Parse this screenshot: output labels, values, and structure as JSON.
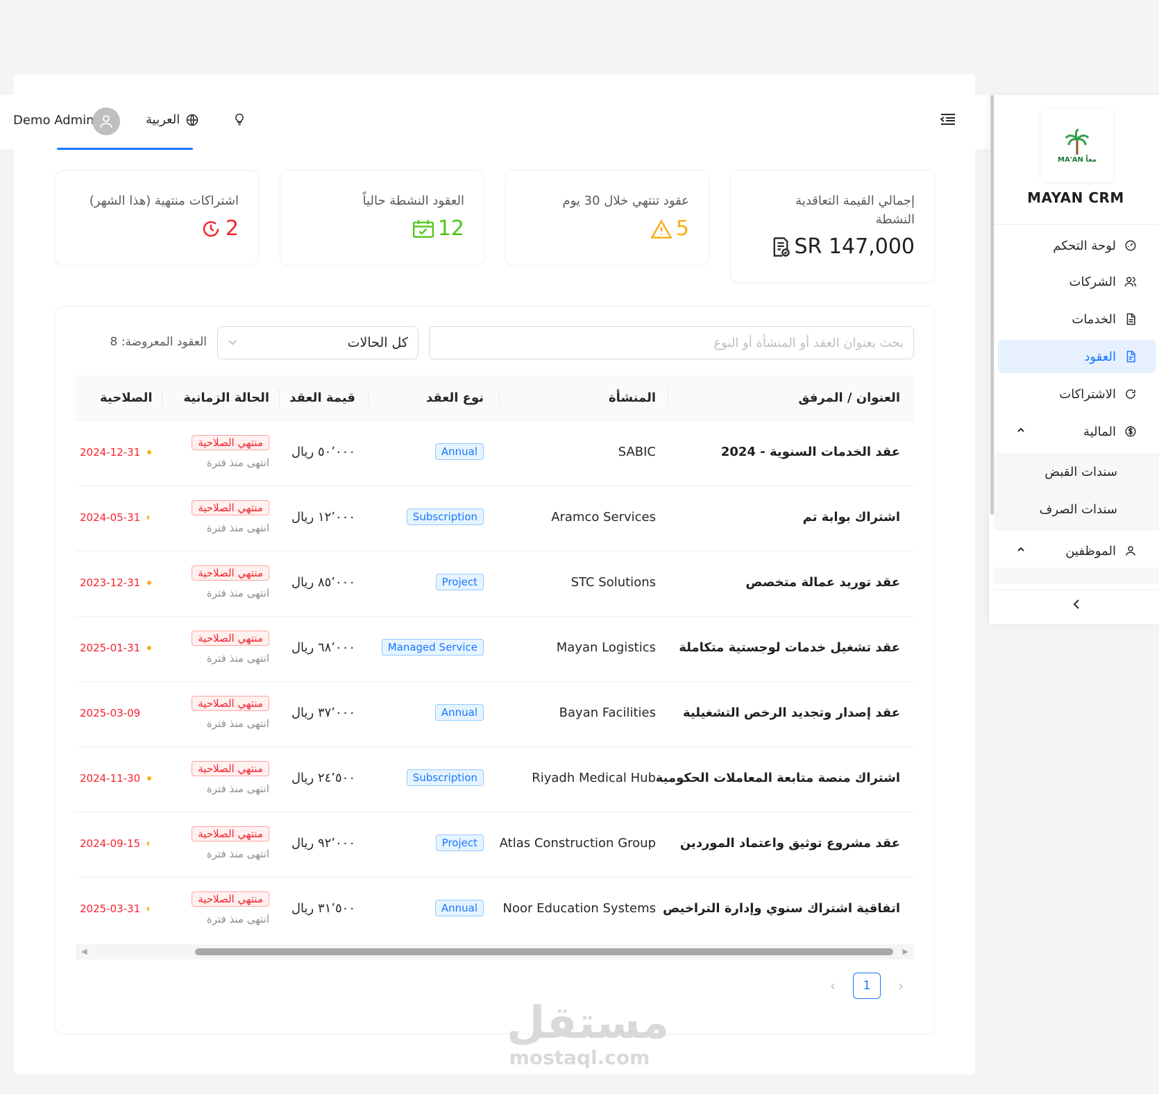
{
  "header": {
    "user_name": "Demo Admin",
    "language": "العربية"
  },
  "sidebar": {
    "brand": "MAYAN CRM",
    "logo_text": "MA'AN معاً",
    "items": [
      {
        "label": "لوحة التحكم",
        "icon": "dashboard-icon"
      },
      {
        "label": "الشركات",
        "icon": "companies-icon"
      },
      {
        "label": "الخدمات",
        "icon": "document-icon"
      },
      {
        "label": "العقود",
        "icon": "contract-icon"
      },
      {
        "label": "الاشتراكات",
        "icon": "refresh-icon"
      },
      {
        "label": "المالية",
        "icon": "dollar-icon"
      },
      {
        "label": "الموظفين",
        "icon": "user-icon"
      }
    ],
    "finance_sub": [
      "سندات القبض",
      "سندات الصرف"
    ],
    "active_item": "العقود"
  },
  "stats": [
    {
      "label": "إجمالي القيمة التعاقدية النشطة",
      "value": "SR 147,000",
      "icon": "invoice-icon"
    },
    {
      "label": "عقود تنتهي خلال 30 يوم",
      "value": "5",
      "icon": "warning-icon",
      "color": "#faad14"
    },
    {
      "label": "العقود النشطة حالياً",
      "value": "12",
      "icon": "calendar-check-icon",
      "color": "#52c41a"
    },
    {
      "label": "اشتراكات منتهية (هذا الشهر)",
      "value": "2",
      "icon": "clock-icon",
      "color": "#f5222d"
    }
  ],
  "filters": {
    "search_placeholder": "بحث بعنوان العقد أو المنشأة أو النوع",
    "status_selected": "كل الحالات",
    "count_text": "العقود المعروضة: 8"
  },
  "table": {
    "headers": {
      "title": "العنوان / المرفق",
      "org": "المنشأة",
      "type": "نوع العقد",
      "value": "قيمة العقد",
      "status": "الحالة الزمانية",
      "validity": "الصلاحية"
    },
    "rows": [
      {
        "title": "عقد الخدمات السنوية - 2024",
        "org": "SABIC",
        "type": "Annual",
        "value": "٥٠٬٠٠٠ ريال",
        "badge": "منتهي الصلاحية",
        "sub": "انتهى منذ فترة",
        "date": "2024-12-31",
        "dot": true
      },
      {
        "title": "اشتراك بوابة تم",
        "org": "Aramco Services",
        "type": "Subscription",
        "value": "١٢٬٠٠٠ ريال",
        "badge": "منتهي الصلاحية",
        "sub": "انتهى منذ فترة",
        "date": "2024-05-31",
        "dot": true
      },
      {
        "title": "عقد توريد عمالة متخصص",
        "org": "STC Solutions",
        "type": "Project",
        "value": "٨٥٬٠٠٠ ريال",
        "badge": "منتهي الصلاحية",
        "sub": "انتهى منذ فترة",
        "date": "2023-12-31",
        "dot": true
      },
      {
        "title": "عقد تشغيل خدمات لوجستية متكاملة",
        "org": "Mayan Logistics",
        "type": "Managed Service",
        "value": "٦٨٬٠٠٠ ريال",
        "badge": "منتهي الصلاحية",
        "sub": "انتهى منذ فترة",
        "date": "2025-01-31",
        "dot": true
      },
      {
        "title": "عقد إصدار وتجديد الرخص التشغيلية",
        "org": "Bayan Facilities",
        "type": "Annual",
        "value": "٣٧٬٠٠٠ ريال",
        "badge": "منتهي الصلاحية",
        "sub": "انتهى منذ فترة",
        "date": "2025-03-09",
        "dot": false
      },
      {
        "title": "اشتراك منصة متابعة المعاملات الحكومية",
        "org": "Riyadh Medical Hub",
        "type": "Subscription",
        "value": "٢٤٬٥٠٠ ريال",
        "badge": "منتهي الصلاحية",
        "sub": "انتهى منذ فترة",
        "date": "2024-11-30",
        "dot": true
      },
      {
        "title": "عقد مشروع توثيق واعتماد الموردين",
        "org": "Atlas Construction Group",
        "type": "Project",
        "value": "٩٢٬٠٠٠ ريال",
        "badge": "منتهي الصلاحية",
        "sub": "انتهى منذ فترة",
        "date": "2024-09-15",
        "dot": true
      },
      {
        "title": "اتفاقية اشتراك سنوي وإدارة التراخيص",
        "org": "Noor Education Systems",
        "type": "Annual",
        "value": "٣١٬٥٠٠ ريال",
        "badge": "منتهي الصلاحية",
        "sub": "انتهى منذ فترة",
        "date": "2025-03-31",
        "dot": true
      }
    ]
  },
  "pagination": {
    "current": "1"
  },
  "watermark": {
    "big": "مستقل",
    "small": "mostaql.com"
  }
}
